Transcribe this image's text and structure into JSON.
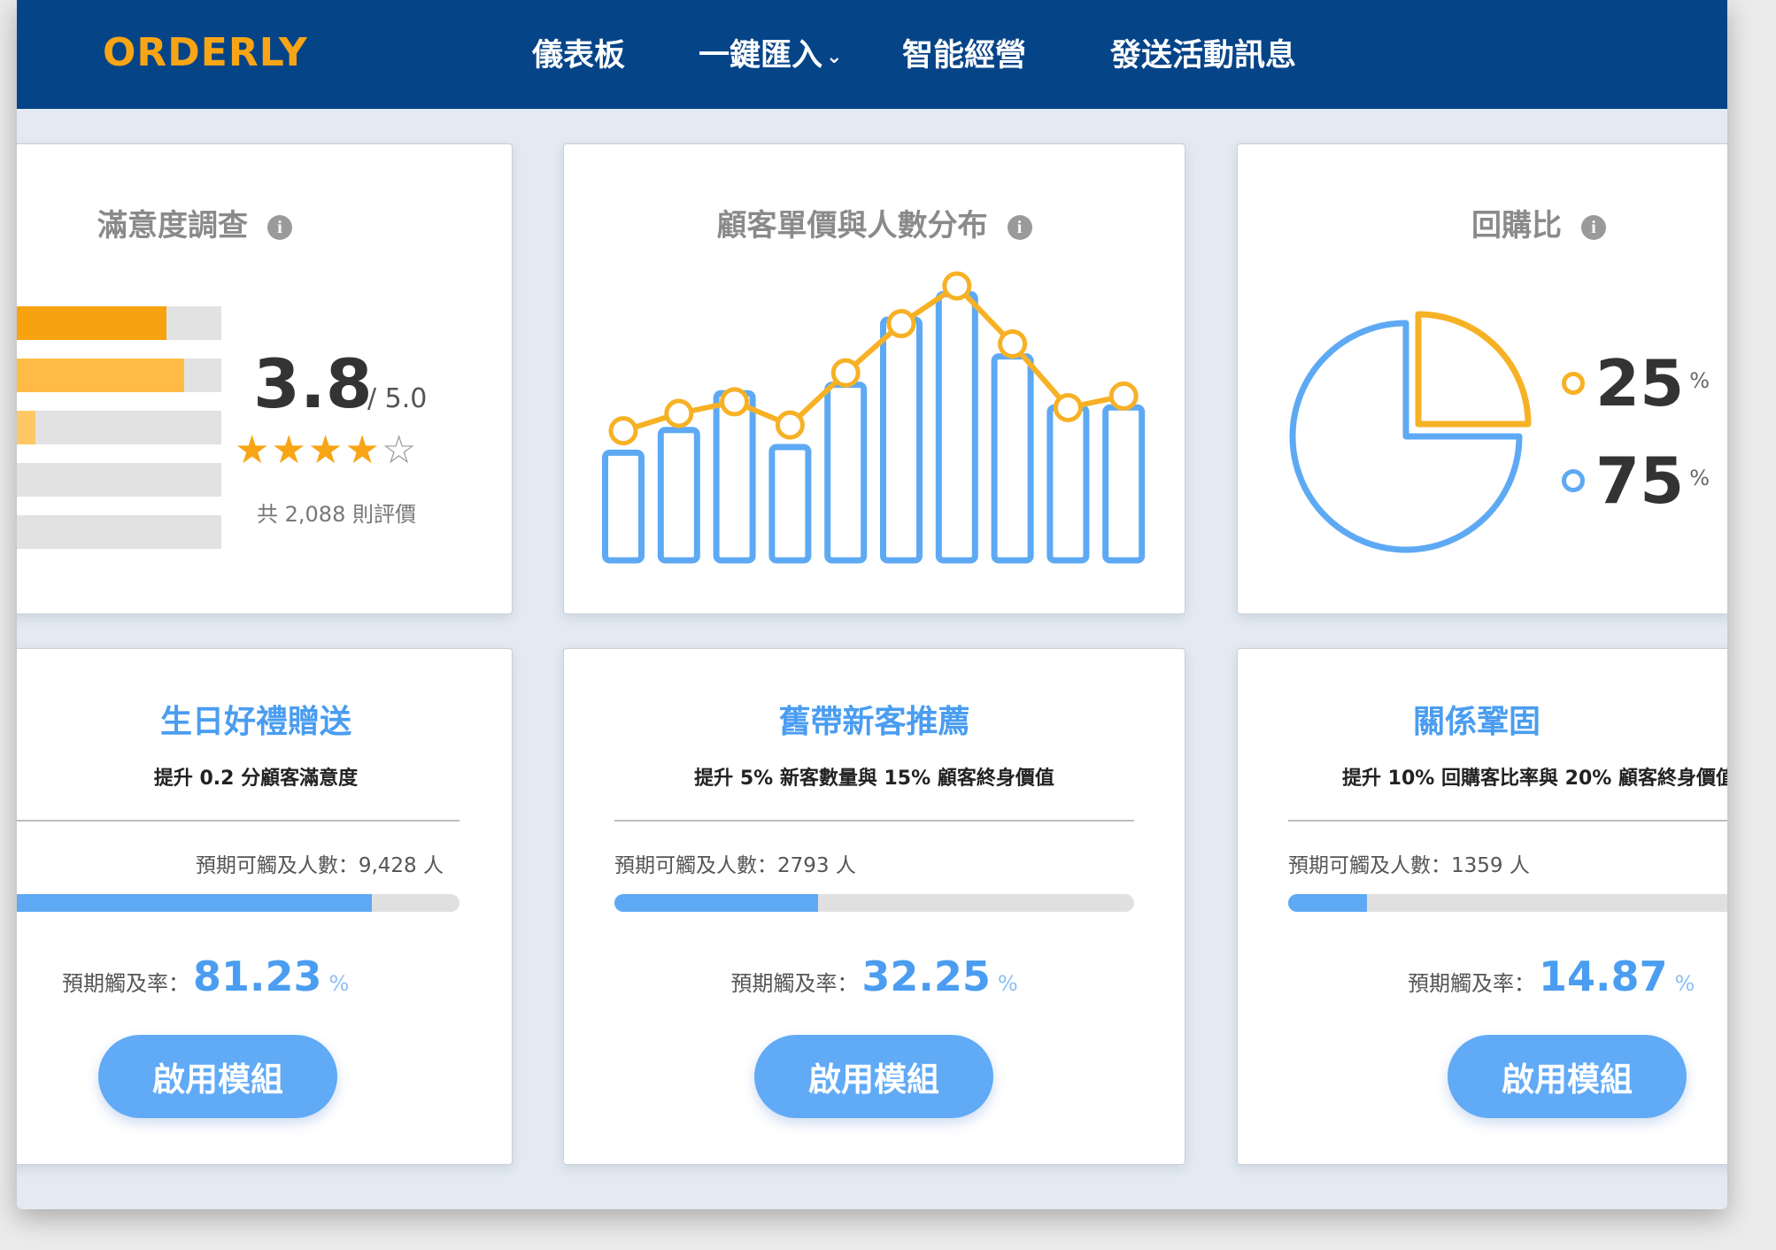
{
  "brand": {
    "logo": "ORDERLY",
    "accent_color": "#f7a515",
    "nav_color": "#064488"
  },
  "nav": {
    "items": [
      "儀表板",
      "一鍵匯入",
      "智能經營",
      "發送活動訊息"
    ],
    "dropdown_chevron": "⌄"
  },
  "satisfaction": {
    "title": "滿意度調查",
    "info_icon": "i",
    "rating": "3.8",
    "rating_max": "/ 5.0",
    "stars_filled": 4,
    "stars_total": 5,
    "review_count": "共 2,088 則評價",
    "distribution": [
      0.75,
      0.83,
      0.16,
      0.0,
      0.0
    ]
  },
  "distribution_chart": {
    "title": "顧客單價與人數分布",
    "info_icon": "i"
  },
  "chart_data": {
    "type": "bar",
    "title": "顧客單價與人數分布",
    "categories": [
      "",
      "",
      "",
      "",
      "",
      "",
      "",
      "",
      "",
      ""
    ],
    "series": [
      {
        "type": "bar",
        "values": [
          38,
          46,
          59,
          40,
          62,
          85,
          94,
          72,
          54,
          54
        ],
        "color": "#5ea9f4"
      },
      {
        "type": "line",
        "values": [
          50,
          56,
          60,
          52,
          70,
          87,
          100,
          80,
          58,
          62
        ],
        "color": "#f7b125"
      }
    ],
    "ylim": [
      0,
      100
    ],
    "grid": false,
    "legend": "none"
  },
  "repurchase": {
    "title": "回購比",
    "info_icon": "i",
    "items": [
      {
        "value": "25",
        "unit": "%",
        "color": "#f7b125"
      },
      {
        "value": "75",
        "unit": "%",
        "color": "#5ea9f4"
      }
    ],
    "pie_fractions": [
      0.25,
      0.75
    ]
  },
  "modules": [
    {
      "title": "生日好禮贈送",
      "subtitle": "提升 0.2 分顧客滿意度",
      "reach": "預期可觸及人數：9,428 人",
      "progress": 0.8123,
      "rate_label": "預期觸及率：",
      "rate": "81.23",
      "rate_unit": "%",
      "button": "啟用模組"
    },
    {
      "title": "舊帶新客推薦",
      "subtitle": "提升 5% 新客數量與 15% 顧客終身價值",
      "reach": "預期可觸及人數：2793 人",
      "progress": 0.3925,
      "rate_label": "預期觸及率：",
      "rate": "32.25",
      "rate_unit": "%",
      "button": "啟用模組"
    },
    {
      "title": "關係鞏固",
      "subtitle": "提升 10% 回購客比率與 20% 顧客終身價值",
      "reach": "預期可觸及人數：1359 人",
      "progress": 0.1487,
      "rate_label": "預期觸及率：",
      "rate": "14.87",
      "rate_unit": "%",
      "button": "啟用模組"
    }
  ]
}
